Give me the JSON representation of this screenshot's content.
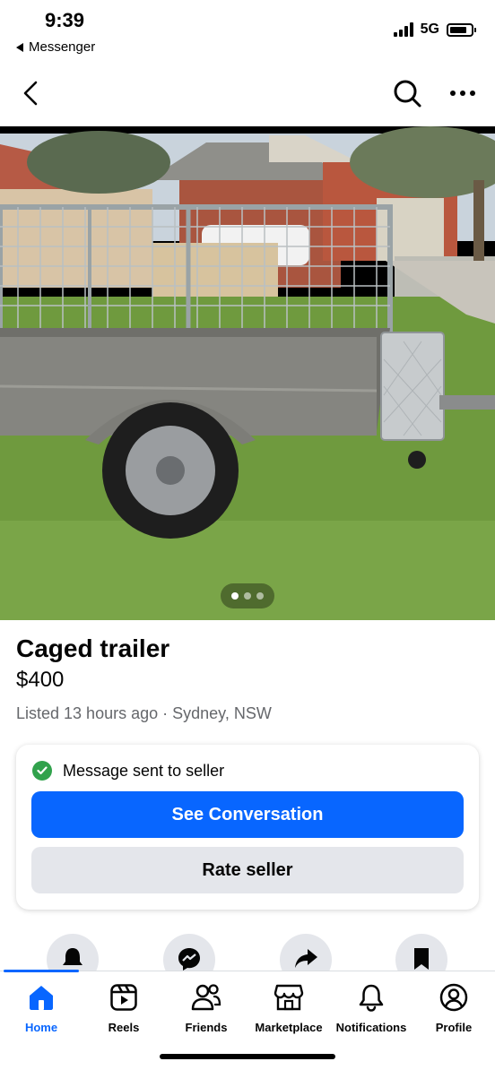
{
  "status_bar": {
    "time": "9:39",
    "back_app": "Messenger",
    "network": "5G",
    "battery_level": 0.8
  },
  "listing": {
    "title": "Caged trailer",
    "price": "$400",
    "meta": "Listed 13 hours ago · Sydney, NSW",
    "photo_count": 3,
    "active_photo": 1
  },
  "message_card": {
    "status_text": "Message sent to seller",
    "primary_button": "See Conversation",
    "secondary_button": "Rate seller"
  },
  "actions": [
    "bell-icon",
    "messenger-icon",
    "share-icon",
    "bookmark-icon"
  ],
  "tabs": [
    {
      "label": "Home",
      "icon": "home-icon",
      "active": true
    },
    {
      "label": "Reels",
      "icon": "reels-icon",
      "active": false
    },
    {
      "label": "Friends",
      "icon": "friends-icon",
      "active": false
    },
    {
      "label": "Marketplace",
      "icon": "marketplace-icon",
      "active": false
    },
    {
      "label": "Notifications",
      "icon": "bell-icon",
      "active": false
    },
    {
      "label": "Profile",
      "icon": "profile-icon",
      "active": false
    }
  ],
  "colors": {
    "accent": "#0866ff",
    "success": "#31a24c",
    "secondary_button": "#e4e6eb",
    "muted_text": "#65676b"
  }
}
